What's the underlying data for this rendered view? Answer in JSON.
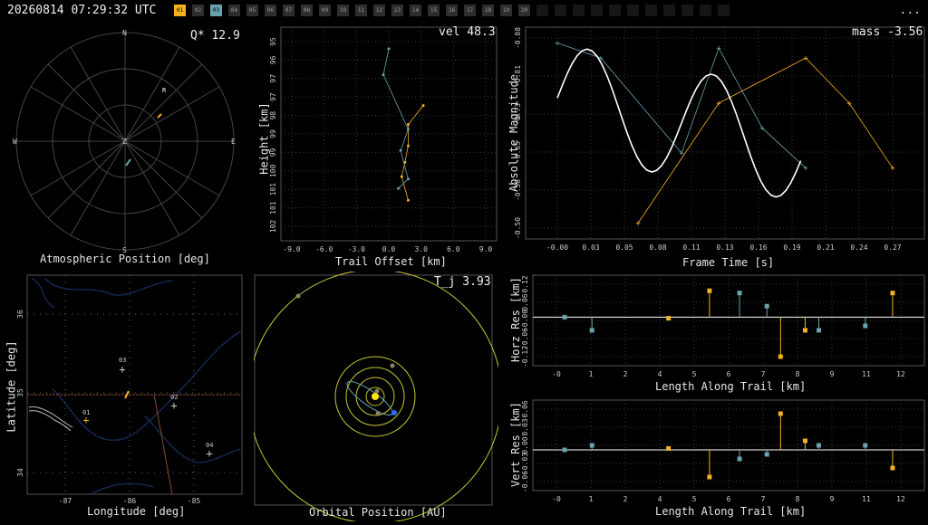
{
  "header": {
    "timestamp": "20260814 07:29:32 UTC",
    "menu_label": "...",
    "stations": [
      {
        "label": "01",
        "state": "a"
      },
      {
        "label": "02",
        "state": "off"
      },
      {
        "label": "03",
        "state": "b"
      },
      {
        "label": "04",
        "state": "off"
      },
      {
        "label": "05",
        "state": "off"
      },
      {
        "label": "06",
        "state": "off"
      },
      {
        "label": "07",
        "state": "off"
      },
      {
        "label": "08",
        "state": "off"
      },
      {
        "label": "09",
        "state": "off"
      },
      {
        "label": "10",
        "state": "off"
      },
      {
        "label": "11",
        "state": "off"
      },
      {
        "label": "12",
        "state": "off"
      },
      {
        "label": "13",
        "state": "off"
      },
      {
        "label": "14",
        "state": "off"
      },
      {
        "label": "15",
        "state": "off"
      },
      {
        "label": "16",
        "state": "off"
      },
      {
        "label": "17",
        "state": "off"
      },
      {
        "label": "18",
        "state": "off"
      },
      {
        "label": "19",
        "state": "off"
      },
      {
        "label": "20",
        "state": "off"
      },
      {
        "label": "",
        "state": "dim"
      },
      {
        "label": "",
        "state": "dim"
      },
      {
        "label": "",
        "state": "dim"
      },
      {
        "label": "",
        "state": "dim"
      },
      {
        "label": "",
        "state": "dim"
      },
      {
        "label": "",
        "state": "dim"
      },
      {
        "label": "",
        "state": "dim"
      },
      {
        "label": "",
        "state": "dim"
      },
      {
        "label": "",
        "state": "dim"
      },
      {
        "label": "",
        "state": "dim"
      },
      {
        "label": "",
        "state": "dim"
      }
    ]
  },
  "colors": {
    "station_a": "#f5b11e",
    "station_b": "#6aa3b0",
    "grid": "#444444",
    "orbit": "#c8c832",
    "fit": "#ffffff"
  },
  "panels": {
    "sky": {
      "title": "Atmospheric Position [deg]",
      "readout": "Q* 12.9",
      "cardinals": {
        "n": "N",
        "s": "S",
        "e": "E",
        "w": "W",
        "z": "Z",
        "r": "R"
      }
    },
    "height": {
      "title": "Trail Offset [km]",
      "ylabel": "Height [km]",
      "readout": "vel 48.3",
      "xticks": [
        "-9.0",
        "-6.0",
        "-3.0",
        "0.0",
        "3.0",
        "6.0",
        "9.0"
      ],
      "yticks": [
        "95",
        "96",
        "97",
        "97",
        "98",
        "99",
        "99",
        "100",
        "101",
        "101",
        "102"
      ]
    },
    "magnitude": {
      "title": "Frame Time [s]",
      "ylabel": "Absolute Magnitude",
      "readout": "mass -3.56",
      "xticks": [
        "-0.00",
        "0.03",
        "0.05",
        "0.08",
        "0.11",
        "0.13",
        "0.16",
        "0.19",
        "0.21",
        "0.24",
        "0.27"
      ],
      "yticks": [
        "-0.88",
        "-0.81",
        "-0.73",
        "-0.65",
        "-0.58",
        "-0.50"
      ]
    },
    "map": {
      "title": "Longitude [deg]",
      "ylabel": "Latitude [deg]",
      "xticks": [
        "-87",
        "-86",
        "-85"
      ],
      "yticks": [
        "36",
        "35",
        "34"
      ],
      "station_labels": [
        "01",
        "02",
        "03",
        "04"
      ]
    },
    "orbit": {
      "title": "Orbital Position [AU]",
      "readout": "T_j 3.93"
    },
    "horz": {
      "title": "Length Along Trail [km]",
      "ylabel": "Horz Res [km]",
      "xticks": [
        "-0",
        "1",
        "2",
        "4",
        "5",
        "6",
        "7",
        "8",
        "9",
        "11",
        "12"
      ],
      "yticks": [
        "0.12",
        "0.06",
        "-0.00",
        "-0.06",
        "-0.12"
      ]
    },
    "vert": {
      "title": "Length Along Trail [km]",
      "ylabel": "Vert Res [km]",
      "xticks": [
        "-0",
        "1",
        "2",
        "4",
        "5",
        "6",
        "7",
        "8",
        "9",
        "11",
        "12"
      ],
      "yticks": [
        "0.06",
        "0.03",
        "0.00",
        "-0.03",
        "-0.06"
      ]
    }
  },
  "chart_data": [
    {
      "type": "scatter",
      "name": "height_vs_offset",
      "series": [
        {
          "station": "01",
          "x": [
            3.2,
            1.8,
            1.8,
            1.5,
            1.2,
            1.8
          ],
          "y": [
            100.3,
            99.5,
            98.6,
            97.9,
            97.3,
            96.3
          ]
        },
        {
          "station": "03",
          "x": [
            0.0,
            -0.5,
            1.8,
            1.1,
            1.8,
            0.9
          ],
          "y": [
            102.7,
            101.6,
            99.3,
            98.4,
            97.2,
            96.8
          ]
        }
      ]
    },
    {
      "type": "line",
      "name": "magnitude_vs_time",
      "series": [
        {
          "station": "01",
          "x": [
            0.065,
            0.13,
            0.2,
            0.235,
            0.27
          ],
          "y": [
            -0.51,
            -0.75,
            -0.84,
            -0.75,
            -0.62
          ]
        },
        {
          "station": "03",
          "x": [
            -0.0,
            0.035,
            0.1,
            0.13,
            0.165,
            0.2
          ],
          "y": [
            -0.87,
            -0.84,
            -0.65,
            -0.86,
            -0.7,
            -0.62
          ]
        }
      ]
    },
    {
      "type": "scatter",
      "name": "horz_residuals",
      "series": [
        {
          "station": "01",
          "x": [
            3.8,
            5.3,
            7.9,
            8.8,
            12.0
          ],
          "y": [
            -0.005,
            0.12,
            -0.18,
            -0.06,
            0.11
          ]
        },
        {
          "station": "03",
          "x": [
            0,
            1.0,
            6.4,
            7.4,
            9.3,
            11.0
          ],
          "y": [
            0.0,
            -0.06,
            0.11,
            0.05,
            -0.06,
            -0.04
          ]
        }
      ]
    },
    {
      "type": "scatter",
      "name": "vert_residuals",
      "series": [
        {
          "station": "01",
          "x": [
            3.8,
            5.3,
            7.9,
            8.8,
            12.0
          ],
          "y": [
            0.003,
            -0.06,
            0.08,
            0.02,
            -0.04
          ]
        },
        {
          "station": "03",
          "x": [
            0,
            1.0,
            6.4,
            7.4,
            9.3,
            11.0
          ],
          "y": [
            0.0,
            0.01,
            -0.02,
            -0.01,
            0.01,
            0.01
          ]
        }
      ]
    }
  ]
}
